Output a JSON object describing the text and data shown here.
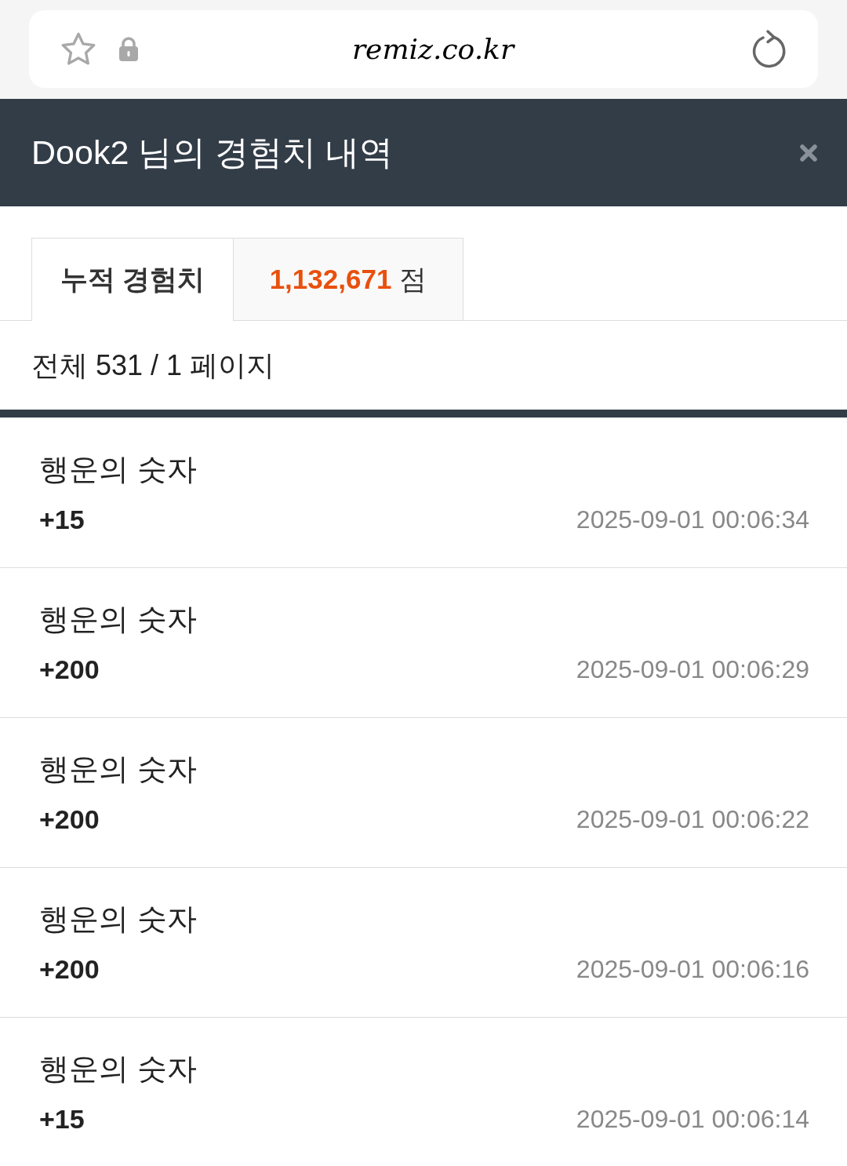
{
  "browser": {
    "url": "remiz.co.kr"
  },
  "header": {
    "title": "Dook2 님의 경험치 내역"
  },
  "summary": {
    "label": "누적 경험치",
    "value": "1,132,671",
    "unit": "점"
  },
  "page_info": "전체 531 / 1 페이지",
  "entries": [
    {
      "title": "행운의 숫자",
      "amount": "+15",
      "datetime": "2025-09-01 00:06:34"
    },
    {
      "title": "행운의 숫자",
      "amount": "+200",
      "datetime": "2025-09-01 00:06:29"
    },
    {
      "title": "행운의 숫자",
      "amount": "+200",
      "datetime": "2025-09-01 00:06:22"
    },
    {
      "title": "행운의 숫자",
      "amount": "+200",
      "datetime": "2025-09-01 00:06:16"
    },
    {
      "title": "행운의 숫자",
      "amount": "+15",
      "datetime": "2025-09-01 00:06:14"
    }
  ]
}
